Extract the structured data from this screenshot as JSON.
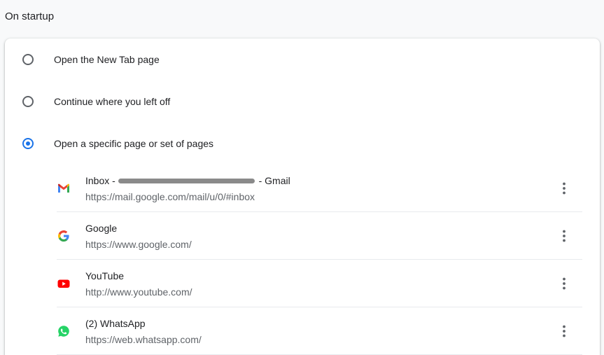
{
  "section": {
    "title": "On startup"
  },
  "options": [
    {
      "label": "Open the New Tab page",
      "checked": false
    },
    {
      "label": "Continue where you left off",
      "checked": false
    },
    {
      "label": "Open a specific page or set of pages",
      "checked": true
    }
  ],
  "pages": [
    {
      "title_prefix": "Inbox - ",
      "title_suffix": " - Gmail",
      "url": "https://mail.google.com/mail/u/0/#inbox",
      "icon": "gmail-icon"
    },
    {
      "title": "Google",
      "url": "https://www.google.com/",
      "icon": "google-icon"
    },
    {
      "title": "YouTube",
      "url": "http://www.youtube.com/",
      "icon": "youtube-icon"
    },
    {
      "title": "(2) WhatsApp",
      "url": "https://web.whatsapp.com/",
      "icon": "whatsapp-icon"
    }
  ],
  "colors": {
    "accent": "#1a73e8",
    "text": "#202124",
    "secondary_text": "#5f6368"
  }
}
